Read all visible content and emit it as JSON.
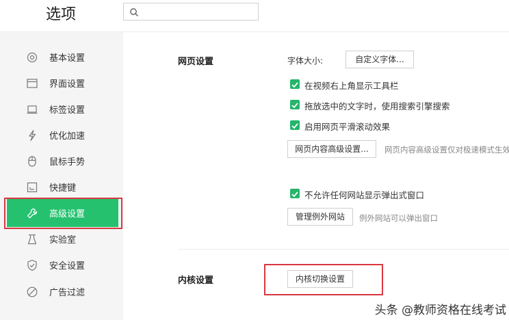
{
  "header": {
    "title": "选项",
    "search_placeholder": ""
  },
  "sidebar": {
    "items": [
      {
        "label": "基本设置",
        "icon": "settings-icon"
      },
      {
        "label": "界面设置",
        "icon": "window-icon"
      },
      {
        "label": "标签设置",
        "icon": "tab-icon"
      },
      {
        "label": "优化加速",
        "icon": "lightning-icon"
      },
      {
        "label": "鼠标手势",
        "icon": "mouse-icon"
      },
      {
        "label": "快捷键",
        "icon": "keyboard-icon"
      },
      {
        "label": "高级设置",
        "icon": "wrench-icon",
        "active": true
      },
      {
        "label": "实验室",
        "icon": "flask-icon"
      },
      {
        "label": "安全设置",
        "icon": "shield-icon"
      },
      {
        "label": "广告过滤",
        "icon": "block-icon"
      }
    ]
  },
  "webpage": {
    "title": "网页设置",
    "font_size_label": "字体大小:",
    "custom_font_button": "自定义字体...",
    "checkboxes": [
      {
        "label": "在视频右上角显示工具栏",
        "checked": true
      },
      {
        "label": "拖放选中的文字时，使用搜索引擎搜索",
        "checked": true
      },
      {
        "label": "启用网页平滑滚动效果",
        "checked": true
      }
    ],
    "advanced_button": "网页内容高级设置...",
    "advanced_hint": "网页内容高级设置仅对极速模式生效",
    "popup_checkbox": {
      "label": "不允许任何网站显示弹出式窗口",
      "checked": true
    },
    "exceptions_button": "管理例外网站",
    "exceptions_hint": "例外网站可以弹出窗口"
  },
  "kernel": {
    "title": "内核设置",
    "switch_button": "内核切换设置"
  },
  "watermark": "头条 @教师资格在线考试",
  "colors": {
    "accent": "#25c16f",
    "highlight_border": "#d9363e"
  }
}
